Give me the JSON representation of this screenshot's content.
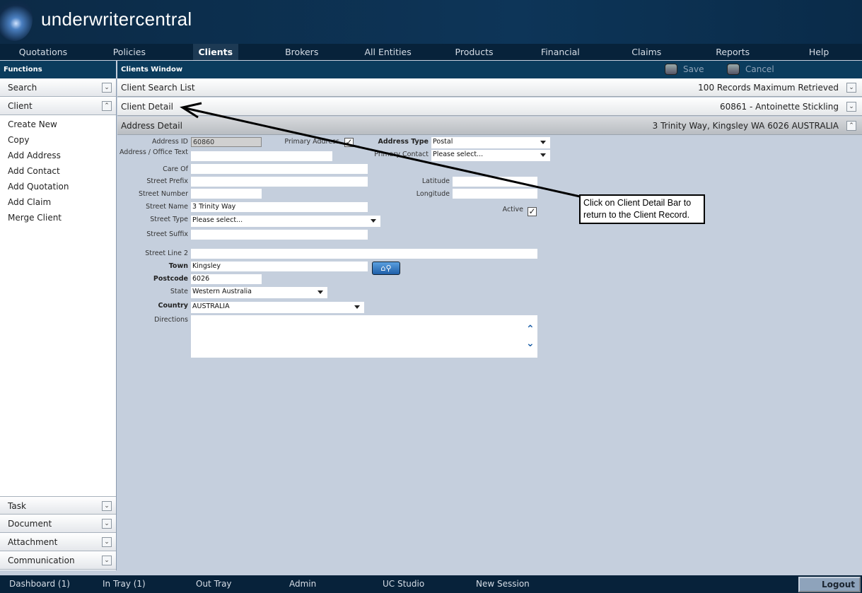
{
  "app": {
    "title": "underwritercentral"
  },
  "nav": [
    "Quotations",
    "Policies",
    "Clients",
    "Brokers",
    "All Entities",
    "Products",
    "Financial",
    "Claims",
    "Reports",
    "Help"
  ],
  "nav_active": "Clients",
  "functions_title": "Functions",
  "window_title": "Clients Window",
  "toolbar": {
    "save": "Save",
    "cancel": "Cancel"
  },
  "sidebar": {
    "search": "Search",
    "client": "Client",
    "client_items": [
      "Create New",
      "Copy",
      "Add Address",
      "Add Contact",
      "Add Quotation",
      "Add Claim",
      "Merge Client"
    ],
    "bottom": [
      "Task",
      "Document",
      "Attachment",
      "Communication"
    ]
  },
  "bars": {
    "search_list": {
      "label": "Client Search List",
      "right": "100 Records Maximum Retrieved"
    },
    "client_detail": {
      "label": "Client Detail",
      "right": "60861 - Antoinette Stickling"
    },
    "address_detail": {
      "label": "Address Detail",
      "right": "3 Trinity Way, Kingsley WA 6026 AUSTRALIA"
    }
  },
  "form": {
    "address_id": {
      "label": "Address ID",
      "value": "60860"
    },
    "office_text": {
      "label": "Address / Office Text",
      "value": ""
    },
    "care_of": {
      "label": "Care Of",
      "value": ""
    },
    "street_prefix": {
      "label": "Street Prefix",
      "value": ""
    },
    "street_number": {
      "label": "Street Number",
      "value": ""
    },
    "street_name": {
      "label": "Street Name",
      "value": "3 Trinity Way"
    },
    "street_type": {
      "label": "Street Type",
      "value": "Please select..."
    },
    "street_suffix": {
      "label": "Street Suffix",
      "value": ""
    },
    "street_line2": {
      "label": "Street Line 2",
      "value": ""
    },
    "town": {
      "label": "Town",
      "value": "Kingsley"
    },
    "postcode": {
      "label": "Postcode",
      "value": "6026"
    },
    "state": {
      "label": "State",
      "value": "Western Australia"
    },
    "country": {
      "label": "Country",
      "value": "AUSTRALIA"
    },
    "directions": {
      "label": "Directions",
      "value": ""
    },
    "primary_address": {
      "label": "Primary Address",
      "checked": true
    },
    "address_type": {
      "label": "Address Type",
      "value": "Postal"
    },
    "primary_contact": {
      "label": "Primary Contact",
      "value": "Please select..."
    },
    "latitude": {
      "label": "Latitude",
      "value": ""
    },
    "longitude": {
      "label": "Longitude",
      "value": ""
    },
    "active": {
      "label": "Active",
      "checked": true
    }
  },
  "callout": "Click on Client Detail Bar to return to the Client Record.",
  "footer": [
    "Dashboard (1)",
    "In Tray (1)",
    "Out Tray",
    "Admin",
    "UC Studio",
    "New Session"
  ],
  "logout": "Logout"
}
